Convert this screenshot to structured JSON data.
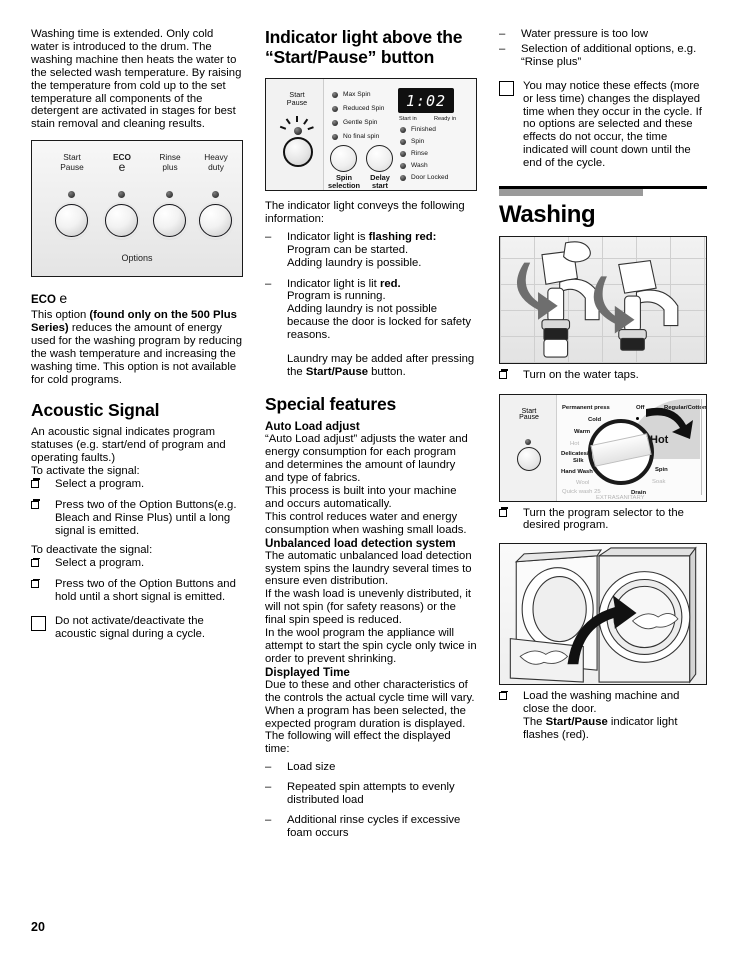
{
  "page": {
    "number": "20"
  },
  "left": {
    "intro": "Washing time is extended. Only cold water is introduced to the drum. The washing machine then heats the water to the selected wash temperature. By raising the temperature  from cold up to the set temperature all components of the detergent are activated in stages for best stain removal and cleaning results.",
    "panel_figure": {
      "buttons": [
        {
          "line1": "Start",
          "line2": "Pause"
        },
        {
          "line1": "ECO",
          "line2": "e"
        },
        {
          "line1": "Rinse",
          "line2": "plus"
        },
        {
          "line1": "Heavy",
          "line2": "duty"
        }
      ],
      "caption": "Options"
    },
    "eco": {
      "heading": "ECO",
      "glyph": "e",
      "text_1": "This option ",
      "text_bold": "(found only on the 500 Plus Series)",
      "text_2": " reduces the amount of energy used for the washing program by reducing the wash temperature and increasing the washing time.  This option is not available for cold programs."
    },
    "acoustic": {
      "heading": "Acoustic Signal",
      "intro": "An acoustic signal indicates program statuses (e.g. start/end of program and operating faults.)",
      "activate_label": "To activate the signal:",
      "activate_steps": [
        "Select a program.",
        "Press two of the Option Buttons(e.g. Bleach and Rinse Plus) until a long signal is emitted."
      ],
      "deactivate_label": "To deactivate the signal:",
      "deactivate_steps": [
        "Select a program.",
        "Press two of the Option Buttons and hold until a short signal is emitted."
      ],
      "note": "Do not activate/deactivate the acoustic signal during a cycle."
    }
  },
  "middle": {
    "heading": "Indicator light above the “Start/Pause” button",
    "display_figure": {
      "start_pause_line1": "Start",
      "start_pause_line2": "Pause",
      "spin_options": [
        "Max Spin",
        "Reduced Spin",
        "Gentle Spin",
        "No final spin"
      ],
      "knob_labels": [
        {
          "line1": "Spin",
          "line2": "selection"
        },
        {
          "line1": "Delay",
          "line2": "start"
        }
      ],
      "lcd_value": "1:02",
      "lcd_left_label": "Start in",
      "lcd_right_label": "Ready in",
      "status_lights": [
        "Finished",
        "Spin",
        "Rinse",
        "Wash",
        "Door Locked"
      ]
    },
    "intro": "The indicator light conveys the following information:",
    "items": [
      {
        "lead": "Indicator light is ",
        "bold": "flashing red:",
        "rest": "Program can be started.\nAdding laundry is possible."
      },
      {
        "lead": "Indicator light is lit ",
        "bold": "red.",
        "rest": "Program is running.\nAdding laundry is not possible because the door is locked for safety reasons."
      }
    ],
    "laundry_note_1": "Laundry may be added after pressing the ",
    "laundry_note_bold": "Start/Pause",
    "laundry_note_2": " button.",
    "special": {
      "heading": "Special features",
      "auto_load_title": "Auto Load adjust",
      "auto_load_text": "“Auto Load adjust” adjusts the water and energy consumption for each program and determines the amount of laundry and type of fabrics.\nThis process is built into your machine and occurs automatically.\nThis control reduces water and energy consumption when washing small loads.",
      "unbalanced_title": "Unbalanced load detection system",
      "unbalanced_text": "The automatic unbalanced load detection system spins the laundry several times to ensure even distribution.\nIf the wash load is unevenly distributed, it will not spin (for safety reasons) or the final spin speed is reduced.\nIn the wool program the appliance will attempt to start the spin cycle only twice in order to prevent shrinking.",
      "displayed_time_title": "Displayed Time",
      "displayed_time_text": "Due to these and other characteristics of the controls the actual cycle time will vary.\nWhen a program has been selected, the expected program duration is displayed.\nThe following will effect the displayed time:",
      "displayed_time_items": [
        "Load size",
        "Repeated spin attempts to evenly distributed load",
        "Additional rinse cycles if excessive foam occurs"
      ]
    }
  },
  "right": {
    "top_items": [
      "Water pressure is too low",
      "Selection of additional options, e.g. “Rinse plus”"
    ],
    "note": "You may notice these effects (more or less time) changes the displayed time when they occur in the cycle. If no options are selected and these effects do not occur, the time indicated will count down until the end of the cycle.",
    "heading": "Washing",
    "steps": [
      {
        "caption": "Turn on the water taps."
      },
      {
        "caption": "Turn the program selector to the desired program."
      },
      {
        "caption": "Load the washing machine and close the door.",
        "extra_1": "The ",
        "extra_bold": "Start/Pause",
        "extra_2": " indicator light flashes (red)."
      }
    ],
    "dial_figure": {
      "start_pause_line1": "Start",
      "start_pause_line2": "Pause",
      "labels": [
        "Permanent press",
        "Off",
        "Regular/Cotton",
        "Cold",
        "Warm",
        "Hot",
        "Delicates/",
        "Silk",
        "Hand Wash",
        "Wool",
        "Quick wash 25",
        "EXTRASANITARY",
        "Drain",
        "Soak",
        "Spin"
      ],
      "highlight": "Hot"
    }
  },
  "colors": {
    "text": "#000000",
    "rule": "#000000",
    "gray_bar": "#9a9a9a",
    "panel_bg": "#f3f3f3",
    "lcd_bg": "#101010"
  }
}
